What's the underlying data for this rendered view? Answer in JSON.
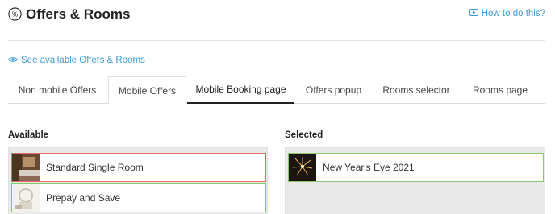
{
  "header": {
    "title": "Offers & Rooms",
    "help_link": "How to do this?"
  },
  "see_link": "See available Offers & Rooms",
  "tabs": [
    {
      "label": "Non mobile Offers"
    },
    {
      "label": "Mobile Offers"
    },
    {
      "label": "Mobile Booking page",
      "active": true
    },
    {
      "label": "Offers popup"
    },
    {
      "label": "Rooms selector"
    },
    {
      "label": "Rooms page"
    }
  ],
  "available": {
    "label": "Available",
    "items": [
      {
        "name": "Standard Single Room",
        "status": "red"
      },
      {
        "name": "Prepay and Save",
        "status": "green"
      }
    ]
  },
  "selected": {
    "label": "Selected",
    "items": [
      {
        "name": "New Year's Eve 2021",
        "status": "green"
      }
    ]
  },
  "colors": {
    "link": "#3a9ad9",
    "error_border": "#e26a6a",
    "ok_border": "#8cc66b",
    "panel_bg": "#e9e9e9"
  },
  "icons": {
    "title": "percent-circle-icon",
    "help": "video-icon",
    "see": "eye-icon"
  }
}
